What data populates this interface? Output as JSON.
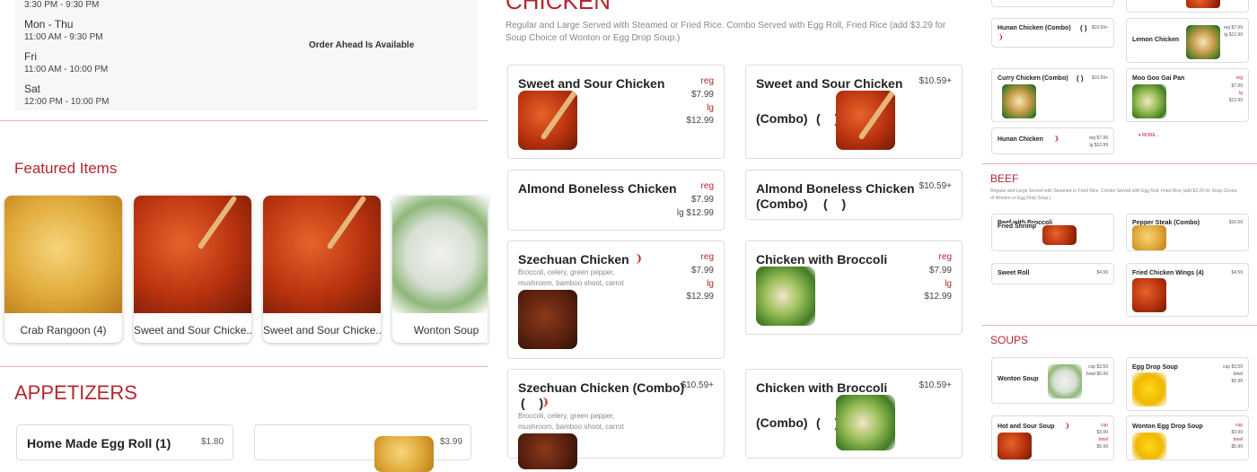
{
  "hours": {
    "top_partial": "3:30 PM - 9:30 PM",
    "rows": [
      {
        "day": "Mon - Thu",
        "time": "11:00 AM - 9:30 PM"
      },
      {
        "day": "Fri",
        "time": "11:00 AM - 10:00 PM"
      },
      {
        "day": "Sat",
        "time": "12:00 PM - 10:00 PM"
      }
    ],
    "order_ahead": "Order Ahead Is Available"
  },
  "featured": {
    "heading": "Featured Items",
    "items": [
      {
        "name": "Crab Rangoon (4)"
      },
      {
        "name": "Sweet and Sour Chicke..."
      },
      {
        "name": "Sweet and Sour Chicke..."
      },
      {
        "name": "Wonton Soup"
      }
    ]
  },
  "appetizers": {
    "heading": "APPETIZERS",
    "items": [
      {
        "name": "Home Made Egg Roll (1)",
        "price": "$1.80"
      },
      {
        "name": "",
        "price": "$3.99"
      }
    ]
  },
  "chicken": {
    "heading": "CHICKEN",
    "description": "Regular and Large Served with Steamed or Fried Rice. Combo Served with Egg Roll, Fried Rice (add $3.29 for Soup Choice of Wonton or Egg Drop Soup.)",
    "items": [
      {
        "name": "Sweet and Sour Chicken",
        "reg_label": "reg",
        "reg_price": "$7.99",
        "lg_label": "lg",
        "lg_price": "$12.99"
      },
      {
        "name": "Sweet and Sour Chicken",
        "combo": "(Combo)",
        "paren": "( )",
        "price": "$10.59+"
      },
      {
        "name": "Almond Boneless Chicken",
        "reg_label": "reg",
        "reg_price": "$7.99",
        "lg_price": "lg $12.99"
      },
      {
        "name": "Almond Boneless Chicken",
        "combo": "(Combo)",
        "paren": "( )",
        "price": "$10.59+"
      },
      {
        "name": "Szechuan Chicken",
        "desc": "Broccoli, celery, green pepper, mushroom, bamboo shoot, carrot",
        "reg_label": "reg",
        "reg_price": "$7.99",
        "lg_label": "lg",
        "lg_price": "$12.99"
      },
      {
        "name": "Chicken with Broccoli",
        "reg_label": "reg",
        "reg_price": "$7.99",
        "lg_label": "lg",
        "lg_price": "$12.99"
      },
      {
        "name": "Szechuan Chicken (Combo)",
        "paren": "( )",
        "desc": "Broccoli, celery, green pepper, mushroom, bamboo shoot, carrot",
        "price": "$10.59+"
      },
      {
        "name": "Chicken with Broccoli",
        "combo": "(Combo)",
        "paren": "( )",
        "price": "$10.59+"
      }
    ]
  },
  "right_col": {
    "chicken_items": [
      {
        "name": "Hunan Chicken (Combo)",
        "paren": "( )",
        "price": "$10.59+"
      },
      {
        "name": "Lemon Chicken",
        "price1": "reg $7.99",
        "price2": "lg $12.99"
      },
      {
        "name": "Curry Chicken (Combo)",
        "paren": "( )",
        "price": "$10.59+"
      },
      {
        "name": "Moo Goo Gai Pan",
        "l1": "reg",
        "p1": "$7.99",
        "l2": "lg",
        "p2": "$12.99"
      },
      {
        "name": "Hunan Chicken",
        "price1": "reg $7.99",
        "price2": "lg $12.99"
      }
    ],
    "more": "▾ MORE...",
    "beef": {
      "heading": "BEEF",
      "description": "Regular and Large Served with Steamed or Fried Rice. Combo Served with Egg Roll, Fried Rice (add $3.29 for Soup Choice of Wonton or Egg Drop Soup.)",
      "items": [
        {
          "name": "Beef with Broccoli",
          "overlay": "Fried Shrimp",
          "price": ""
        },
        {
          "name": "Pepper Steak (Combo)",
          "price": "$10.59"
        },
        {
          "name": "Sweet Roll",
          "price": "$4.99"
        },
        {
          "name": "Fried Chicken Wings (4)",
          "price": "$4.59"
        }
      ]
    },
    "soups": {
      "heading": "SOUPS",
      "items": [
        {
          "name": "Wonton Soup",
          "p1": "cup $3.59",
          "p2": "bowl $5.99"
        },
        {
          "name": "Egg Drop Soup",
          "p1": "cup $3.59",
          "l2": "bowl",
          "p2": "$5.99"
        },
        {
          "name": "Hot and Sour Soup",
          "l1": "cup",
          "p1": "$3.99",
          "l2": "bowl",
          "p2": "$5.99"
        },
        {
          "name": "Wonton Egg Drop Soup",
          "l1": "cup",
          "p1": "$3.99",
          "l2": "bowl",
          "p2": "$5.99"
        }
      ]
    }
  },
  "colors": {
    "accent": "#b5262f",
    "divider": "#e3b3b6"
  }
}
